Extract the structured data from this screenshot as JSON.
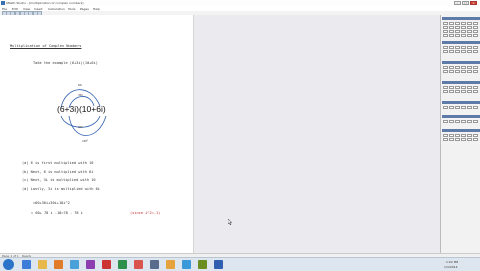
{
  "window": {
    "title": "SMath Studio - [multiplication of complex numbers]"
  },
  "menu": [
    "File",
    "Edit",
    "View",
    "Insert",
    "Calculation",
    "Tools",
    "Pages",
    "Help"
  ],
  "document": {
    "heading": "Multiplication of Complex Numbers",
    "example": "Take the example (6+3i)(10+6i)",
    "expression": "(6+3i)(10+6i)",
    "arcs": [
      "60",
      "36i",
      "30i",
      "18i²"
    ],
    "steps": [
      "(a) 6 is first multiplied with 10",
      "(b) Next, 6 is multiplied with 6i",
      "(c) Next, 3i is multiplied with 10",
      "(d) Lastly, 3i is multiplied with 6i"
    ],
    "equation_1": "=60+36i+30i+18i^2",
    "equation_2": "= 60+ 78 i -18=78 - 78 i",
    "note": "(since i^2=-1)"
  },
  "status": {
    "page": "Page 1 of 1",
    "mode": "Ready"
  },
  "taskbar": {
    "time": "1:02 PM",
    "date": "1/3/2014"
  },
  "colors": {
    "arc_blue": "#2f5fae",
    "note_red": "#c62828",
    "panel_header": "#5d7aa8"
  }
}
